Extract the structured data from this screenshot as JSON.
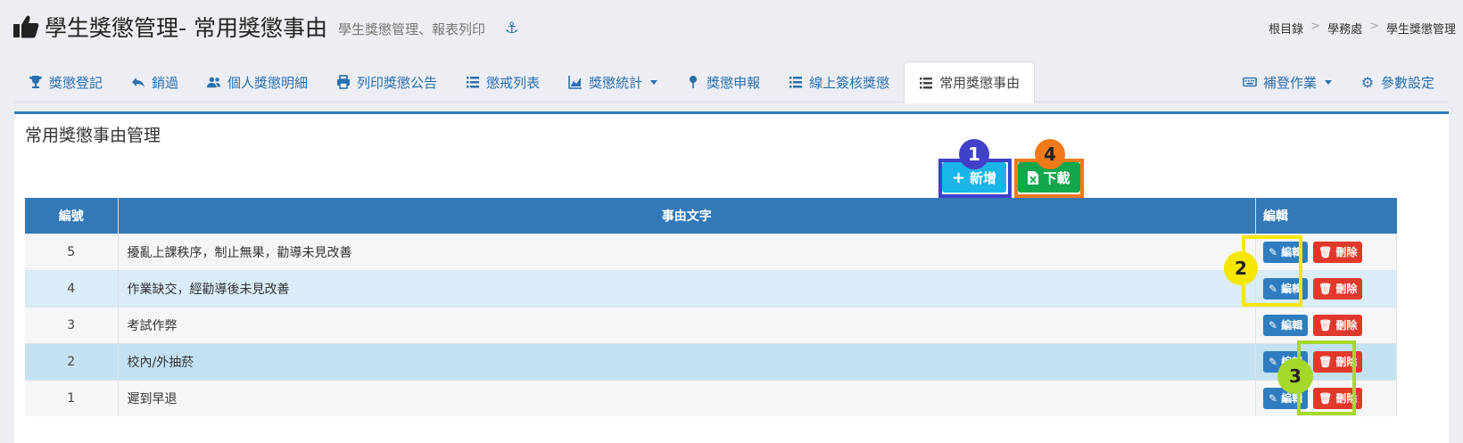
{
  "header": {
    "title": "學生獎懲管理- 常用獎懲事由",
    "subtitle": "學生獎懲管理、報表列印",
    "thumb_icon": "thumbs-up-icon",
    "anchor_icon": "anchor-icon"
  },
  "breadcrumb": {
    "items": [
      "根目錄",
      "學務處",
      "學生獎懲管理"
    ],
    "separator": ">"
  },
  "tabs": [
    {
      "label": "獎懲登記",
      "icon": "trophy-icon"
    },
    {
      "label": "銷過",
      "icon": "reply-icon"
    },
    {
      "label": "個人獎懲明細",
      "icon": "users-icon"
    },
    {
      "label": "列印獎懲公告",
      "icon": "print-icon"
    },
    {
      "label": "懲戒列表",
      "icon": "list-icon"
    },
    {
      "label": "獎懲統計",
      "icon": "chart-icon"
    },
    {
      "label": "獎懲申報",
      "icon": "map-pin-icon"
    },
    {
      "label": "線上簽核獎懲",
      "icon": "list-icon"
    },
    {
      "label": "常用獎懲事由",
      "icon": "list-icon",
      "active": true
    },
    {
      "label": "補登作業",
      "icon": "keyboard-icon"
    },
    {
      "label": "參數設定",
      "icon": "gear-icon"
    }
  ],
  "panel": {
    "title": "常用獎懲事由管理",
    "add_label": "新增",
    "download_label": "下載"
  },
  "table": {
    "columns": [
      "編號",
      "事由文字",
      "編輯"
    ],
    "rows": [
      {
        "id": "5",
        "text": "擾亂上課秩序，制止無果，勸導未見改善"
      },
      {
        "id": "4",
        "text": "作業缺交，經勸導後未見改善"
      },
      {
        "id": "3",
        "text": "考試作弊"
      },
      {
        "id": "2",
        "text": "校內/外抽菸"
      },
      {
        "id": "1",
        "text": "遲到早退"
      }
    ],
    "edit_label": "編輯",
    "delete_label": "刪除"
  },
  "annotations": [
    {
      "number": "1",
      "color": "#4040c8"
    },
    {
      "number": "2",
      "color": "#f5e600"
    },
    {
      "number": "3",
      "color": "#a6d82a"
    },
    {
      "number": "4",
      "color": "#f07a1a"
    }
  ]
}
